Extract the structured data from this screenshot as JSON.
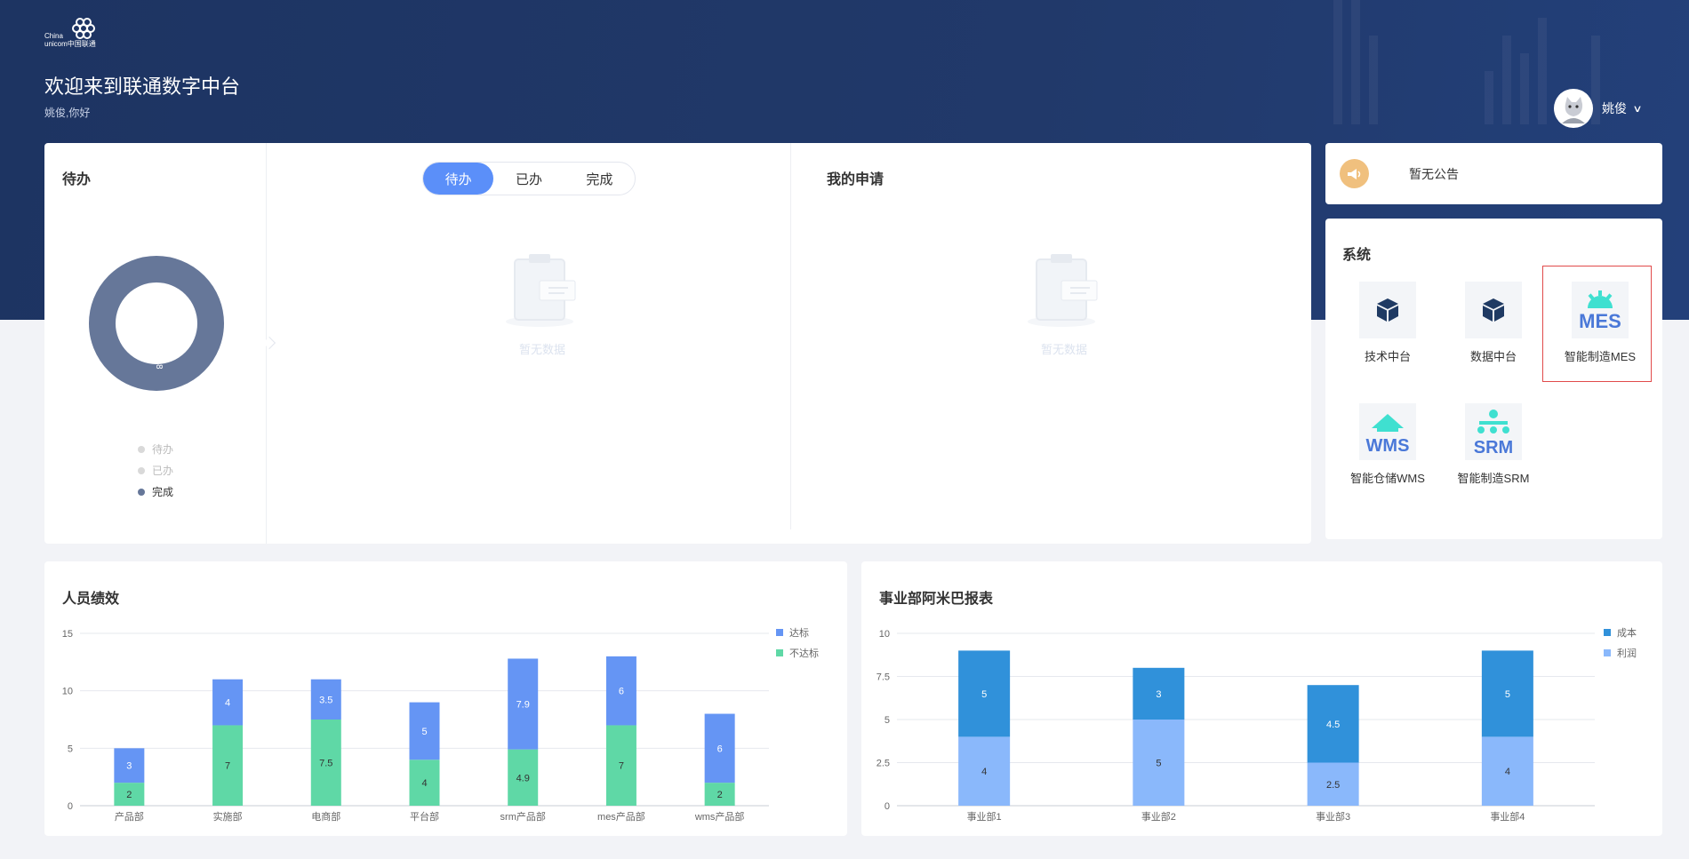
{
  "header": {
    "logo_text_1": "China",
    "logo_text_2": "unicom中国联通",
    "title": "欢迎来到联通数字中台",
    "greeting": "姚俊,你好",
    "user_name": "姚俊"
  },
  "todo_card": {
    "title": "待办",
    "donut_label": "88",
    "legend": [
      "待办",
      "已办",
      "完成"
    ],
    "colors": {
      "done": "#667799",
      "muted": "#d9d9d9"
    }
  },
  "tabs": [
    "待办",
    "已办",
    "完成"
  ],
  "active_tab": 0,
  "empty_text": "暂无数据",
  "my_apply": {
    "title": "我的申请"
  },
  "notice": {
    "text": "暂无公告"
  },
  "systems": {
    "title": "系统",
    "items": [
      {
        "label": "技术中台",
        "icon": "cube-icon"
      },
      {
        "label": "数据中台",
        "icon": "cube-icon"
      },
      {
        "label": "智能制造MES",
        "icon": "mes-logo-icon",
        "logo_text": "MES"
      },
      {
        "label": "智能仓储WMS",
        "icon": "wms-logo-icon",
        "logo_text": "WMS"
      },
      {
        "label": "智能制造SRM",
        "icon": "srm-logo-icon",
        "logo_text": "SRM"
      }
    ]
  },
  "perf_card": {
    "title": "人员绩效"
  },
  "amoeba_card": {
    "title": "事业部阿米巴报表"
  },
  "chart_data": [
    {
      "type": "bar",
      "stacked": true,
      "categories": [
        "产品部",
        "实施部",
        "电商部",
        "平台部",
        "srm产品部",
        "mes产品部",
        "wms产品部"
      ],
      "series": [
        {
          "name": "不达标",
          "values": [
            2,
            7,
            7.5,
            4,
            4.9,
            7,
            2
          ],
          "color": "#5fd8a6"
        },
        {
          "name": "达标",
          "values": [
            3,
            4,
            3.5,
            5,
            7.9,
            6,
            6
          ],
          "color": "#6595f4"
        }
      ],
      "y_ticks": [
        0,
        5,
        10,
        15
      ],
      "ylim": [
        0,
        15
      ],
      "legend_order": [
        "达标",
        "不达标"
      ],
      "legend_position": "top-right",
      "grid": true
    },
    {
      "type": "bar",
      "stacked": true,
      "categories": [
        "事业部1",
        "事业部2",
        "事业部3",
        "事业部4"
      ],
      "series": [
        {
          "name": "利润",
          "values": [
            4,
            5,
            2.5,
            4
          ],
          "color": "#8ab8fb"
        },
        {
          "name": "成本",
          "values": [
            5,
            3,
            4.5,
            5
          ],
          "color": "#3091da"
        }
      ],
      "y_ticks": [
        0,
        2.5,
        5,
        7.5,
        10
      ],
      "ylim": [
        0,
        10
      ],
      "legend_order": [
        "成本",
        "利润"
      ],
      "legend_position": "top-right",
      "grid": true
    }
  ]
}
